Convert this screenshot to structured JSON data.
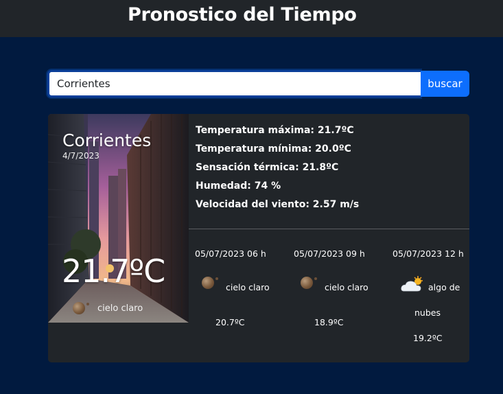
{
  "header": {
    "title": "Pronostico del Tiempo"
  },
  "search": {
    "value": "Corrientes",
    "button_label": "buscar"
  },
  "current": {
    "city": "Corrientes",
    "date": "4/7/2023",
    "temperature": "21.7ºC",
    "condition": "cielo claro",
    "condition_icon": "moon-icon"
  },
  "details": {
    "temp_max": "Temperatura máxima: 21.7ºC",
    "temp_min": "Temperatura mínima: 20.0ºC",
    "feels_like": "Sensación térmica: 21.8ºC",
    "humidity": "Humedad: 74 %",
    "wind": "Velocidad del viento: 2.57 m/s"
  },
  "forecast": [
    {
      "time": "05/07/2023 06 h",
      "condition": "cielo claro",
      "temp": "20.7ºC",
      "icon": "moon-icon"
    },
    {
      "time": "05/07/2023 09 h",
      "condition": "cielo claro",
      "temp": "18.9ºC",
      "icon": "moon-icon"
    },
    {
      "time": "05/07/2023 12 h",
      "condition_line1": "algo de",
      "condition_line2": "nubes",
      "temp": "19.2ºC",
      "icon": "cloud-sun-icon"
    }
  ],
  "colors": {
    "page_bg": "#011a3f",
    "navbar_bg": "#212529",
    "card_bg": "#212529",
    "button_bg": "#0d6efd"
  }
}
